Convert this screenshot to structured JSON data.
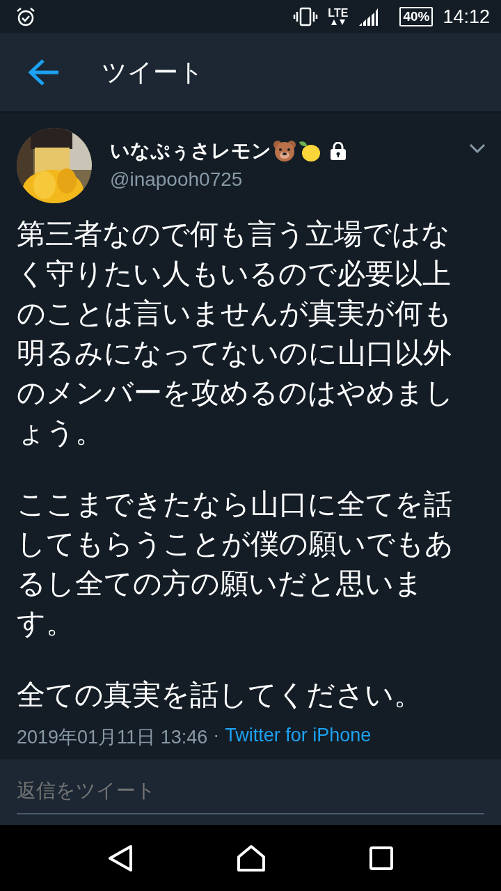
{
  "status_bar": {
    "network": "LTE",
    "battery": "40%",
    "time": "14:12"
  },
  "header": {
    "title": "ツイート"
  },
  "tweet": {
    "author": {
      "name": "いなぷぅさレモン",
      "handle": "@inapooh0725",
      "protected": true
    },
    "paragraphs": [
      "第三者なので何も言う立場ではなく守りたい人もいるので必要以上のことは言いませんが真実が何も明るみになってないのに山口以外のメンバーを攻めるのはやめましょう。",
      "ここまできたなら山口に全てを話してもらうことが僕の願いでもあるし全ての方の願いだと思います。",
      "全ての真実を話してください。"
    ],
    "timestamp": "2019年01月11日 13:46",
    "separator": "·",
    "source": "Twitter for iPhone"
  },
  "reply": {
    "placeholder": "返信をツイート"
  }
}
